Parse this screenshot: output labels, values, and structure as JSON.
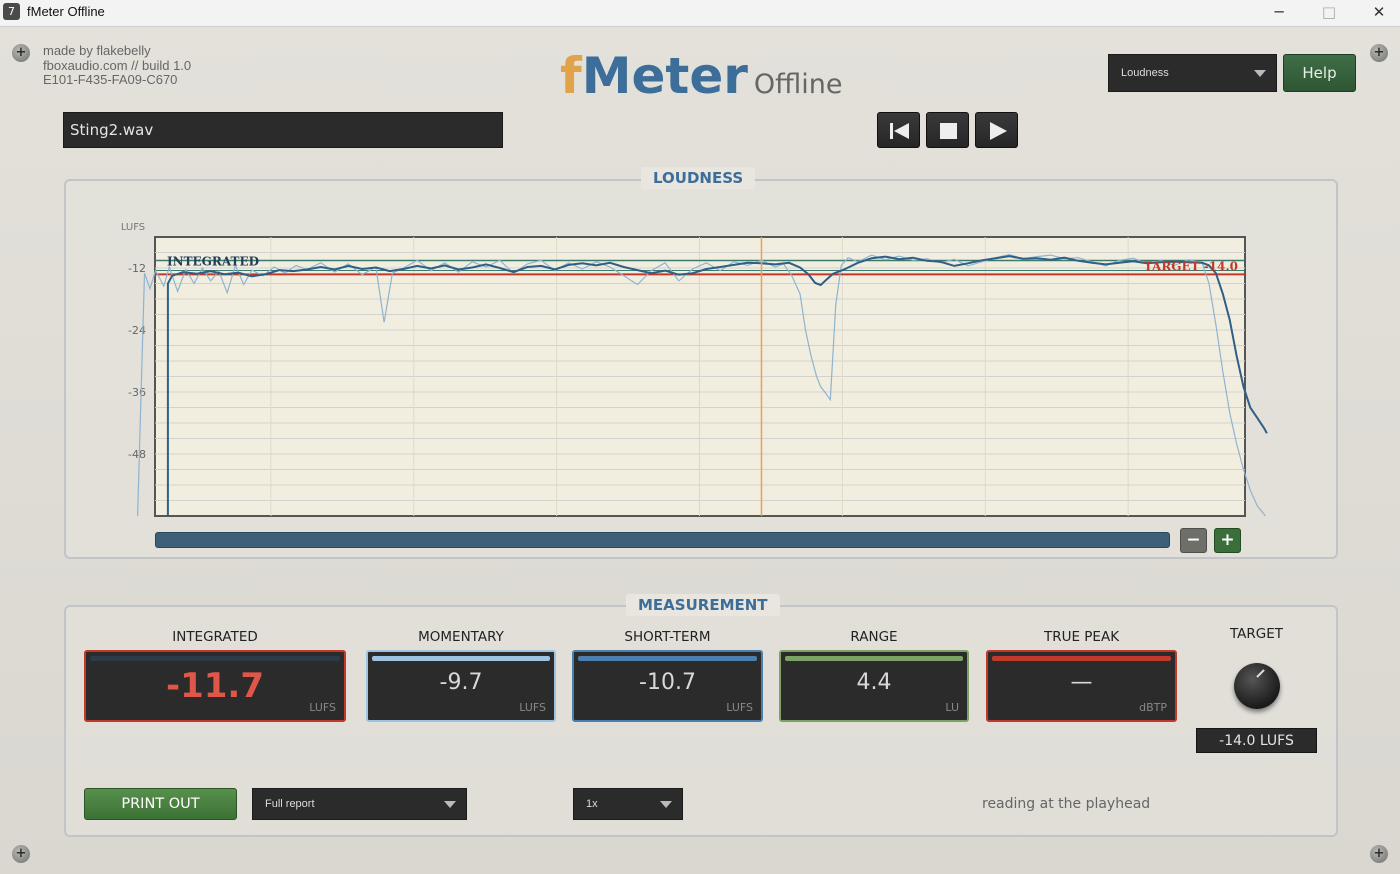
{
  "window": {
    "title": "fMeter Offline",
    "app_icon": "7",
    "minimize": "─",
    "maximize": "□",
    "close": "✕"
  },
  "credits": {
    "line1": "made by flakebelly",
    "line2": "fboxaudio.com // build 1.0",
    "line3": "E101-F435-FA09-C670"
  },
  "logo": {
    "f": "f",
    "meter": "Meter",
    "offline": "Offline"
  },
  "view_select": {
    "value": "Loudness"
  },
  "help_label": "Help",
  "file": {
    "name": "Sting2.wav"
  },
  "transport": {
    "icons": [
      "skip-to-start-icon",
      "stop-icon",
      "play-icon"
    ]
  },
  "loudness": {
    "title": "LOUDNESS",
    "integrated_label": "INTEGRATED",
    "target_label": "TARGET -14.0",
    "zoom_out": "−",
    "zoom_in": "+"
  },
  "chart_data": {
    "type": "line",
    "title": "LOUDNESS",
    "ylabel": "LUFS",
    "y_ticks": [
      -12,
      -24,
      -36,
      -48
    ],
    "ylim": [
      -60,
      -6
    ],
    "x_ticks": [
      "0:00",
      "0:10",
      "0:20",
      "0:31",
      "0:41",
      "0:52",
      "1:02",
      "1:13",
      "1:23"
    ],
    "xlim_seconds": [
      0,
      83
    ],
    "playhead_seconds": 46,
    "integrated_level": -11.7,
    "target_level": -14.0,
    "grid": true,
    "series": [
      {
        "color": "#8fb3cf",
        "x": [
          0.7,
          1.2,
          1.6,
          2.0,
          2.6,
          3.0,
          3.6,
          4.2,
          4.8,
          5.4,
          6.0,
          6.6,
          7.2,
          7.8,
          8.4,
          9.0,
          9.8,
          10.6,
          11.4,
          12.2,
          13.0,
          14.0,
          15.0,
          16.0,
          17.0,
          18.0,
          18.6,
          19.2,
          20.0,
          21.0,
          22.0,
          23.0,
          24.0,
          25.0,
          26.0,
          27.0,
          28.0,
          29.0,
          30.0,
          31.0,
          32.0,
          33.0,
          34.0,
          35.0,
          36.0,
          37.0,
          38.0,
          39.0,
          40.0,
          41.0,
          42.0,
          43.0,
          44.0,
          45.0,
          46.0,
          47.0,
          47.6,
          48.2,
          48.8,
          49.2,
          49.6,
          50.0,
          50.3,
          50.6,
          51.0,
          51.4,
          51.8,
          52.3,
          53.0,
          54.0,
          55.0,
          56.0,
          57.0,
          58.0,
          59.0,
          60.0,
          61.0,
          62.0,
          63.0,
          64.0,
          65.0,
          66.0,
          67.0,
          68.0,
          69.0,
          70.0,
          71.0,
          72.0,
          73.0,
          74.0,
          75.0,
          76.0,
          77.0,
          78.0,
          78.5,
          79.0,
          79.5,
          80.0,
          80.5,
          81.0,
          81.5,
          82.0,
          82.6
        ],
        "y": [
          -60.0,
          -13.0,
          -16.0,
          -12.5,
          -15.5,
          -11.8,
          -16.5,
          -12.3,
          -15.0,
          -12.0,
          -14.5,
          -12.6,
          -16.8,
          -11.5,
          -15.2,
          -12.4,
          -13.5,
          -11.8,
          -13.0,
          -11.5,
          -12.3,
          -11.0,
          -12.8,
          -11.2,
          -13.3,
          -11.8,
          -22.5,
          -13.0,
          -12.0,
          -10.5,
          -12.5,
          -11.0,
          -12.8,
          -10.8,
          -11.8,
          -10.5,
          -13.0,
          -11.2,
          -10.5,
          -12.5,
          -11.0,
          -12.2,
          -10.8,
          -11.8,
          -13.5,
          -15.2,
          -12.5,
          -11.0,
          -14.5,
          -12.2,
          -11.0,
          -12.5,
          -10.8,
          -11.5,
          -10.5,
          -11.8,
          -11.2,
          -13.5,
          -17.0,
          -24.0,
          -29.0,
          -33.0,
          -35.0,
          -36.0,
          -37.5,
          -19.0,
          -11.5,
          -10.0,
          -10.8,
          -9.5,
          -10.4,
          -9.7,
          -10.5,
          -10.2,
          -11.0,
          -10.3,
          -11.6,
          -10.8,
          -10.0,
          -9.4,
          -10.2,
          -9.8,
          -9.5,
          -10.2,
          -10.0,
          -10.8,
          -11.6,
          -10.5,
          -10.1,
          -11.2,
          -10.6,
          -11.5,
          -10.4,
          -11.0,
          -15.0,
          -23.0,
          -32.0,
          -40.0,
          -46.0,
          -51.0,
          -55.0,
          -58.0,
          -60.0
        ]
      },
      {
        "color": "#2e5f85",
        "x": [
          2.9,
          2.9,
          3.2,
          4.0,
          5.0,
          6.0,
          7.0,
          8.0,
          9.0,
          10.0,
          11.0,
          12.0,
          13.0,
          14.0,
          15.0,
          16.0,
          17.0,
          18.0,
          19.0,
          20.0,
          21.0,
          22.0,
          23.0,
          24.0,
          25.0,
          26.0,
          27.0,
          28.0,
          29.0,
          30.0,
          31.0,
          32.0,
          33.0,
          34.0,
          35.0,
          36.0,
          37.0,
          38.0,
          39.0,
          40.0,
          41.0,
          42.0,
          43.0,
          44.0,
          45.0,
          46.0,
          47.0,
          48.0,
          48.8,
          49.4,
          49.9,
          50.3,
          50.7,
          51.2,
          52.0,
          53.0,
          54.0,
          55.0,
          56.0,
          57.0,
          58.0,
          59.0,
          60.0,
          61.0,
          62.0,
          63.0,
          64.0,
          65.0,
          66.0,
          67.0,
          68.0,
          69.0,
          70.0,
          71.0,
          72.0,
          73.0,
          74.0,
          75.0,
          76.0,
          77.0,
          78.0,
          78.5,
          79.0,
          79.5,
          80.0,
          80.5,
          81.0,
          81.5,
          82.0,
          82.5,
          82.7
        ],
        "y": [
          -60.0,
          -15.0,
          -13.5,
          -12.8,
          -13.1,
          -12.6,
          -13.2,
          -12.9,
          -13.6,
          -13.2,
          -12.4,
          -12.6,
          -12.3,
          -11.8,
          -12.3,
          -11.6,
          -12.2,
          -11.9,
          -12.6,
          -12.2,
          -11.6,
          -12.1,
          -11.5,
          -12.3,
          -11.9,
          -11.3,
          -12.0,
          -12.8,
          -11.8,
          -11.6,
          -12.3,
          -11.4,
          -11.1,
          -11.5,
          -11.0,
          -11.8,
          -12.4,
          -13.0,
          -12.5,
          -13.3,
          -13.0,
          -12.2,
          -11.8,
          -11.4,
          -11.0,
          -11.1,
          -11.3,
          -11.0,
          -11.9,
          -13.2,
          -14.9,
          -15.3,
          -14.3,
          -13.1,
          -12.3,
          -11.0,
          -10.1,
          -9.8,
          -10.3,
          -10.0,
          -10.6,
          -10.8,
          -11.6,
          -11.1,
          -10.5,
          -10.1,
          -9.7,
          -10.2,
          -10.1,
          -10.4,
          -10.0,
          -10.6,
          -11.0,
          -11.3,
          -11.0,
          -10.7,
          -11.1,
          -10.9,
          -10.8,
          -10.9,
          -11.0,
          -11.5,
          -13.0,
          -17.0,
          -22.0,
          -29.0,
          -35.0,
          -39.0,
          -41.0,
          -43.0,
          -44.0
        ]
      }
    ]
  },
  "measurement": {
    "title": "MEASUREMENT",
    "meters": [
      {
        "label": "INTEGRATED",
        "value": "-11.7",
        "unit": "LUFS",
        "accent": "#c0392b"
      },
      {
        "label": "MOMENTARY",
        "value": "-9.7",
        "unit": "LUFS",
        "accent": "#9ec3e0"
      },
      {
        "label": "SHORT-TERM",
        "value": "-10.7",
        "unit": "LUFS",
        "accent": "#4a7fb0"
      },
      {
        "label": "RANGE",
        "value": "4.4",
        "unit": "LU",
        "accent": "#7ca266"
      },
      {
        "label": "TRUE PEAK",
        "value": "—",
        "unit": "dBTP",
        "accent": "#c0392b"
      }
    ],
    "target": {
      "label": "TARGET",
      "value": "-14.0 LUFS"
    }
  },
  "bottom": {
    "print_label": "PRINT OUT",
    "report_select": "Full report",
    "speed_select": "1x",
    "status": "reading at the playhead"
  },
  "colors": {
    "accent_blue": "#3c6e99",
    "logo_orange": "#e2a24a",
    "help_green": "#2e5634",
    "print_green": "#4c8443",
    "target_red": "#c0392b",
    "playhead_orange": "#e8a24c"
  }
}
